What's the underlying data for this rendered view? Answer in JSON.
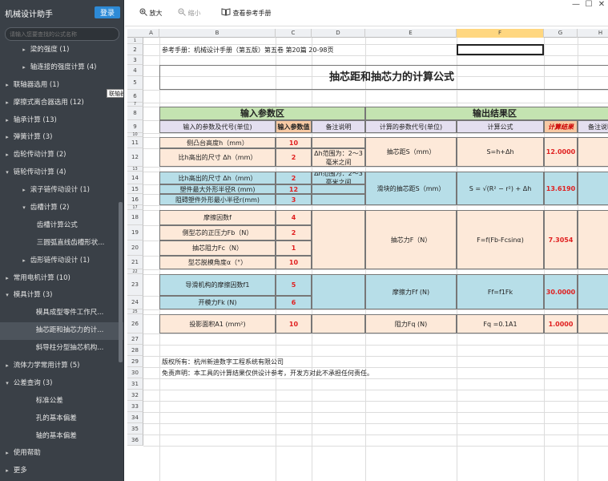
{
  "app": {
    "title": "机械设计助手",
    "login_label": "登录",
    "search_placeholder": "请输入您要查找的公式名称"
  },
  "sidebar": {
    "items": [
      {
        "label": "梁的强度 (1)",
        "level": 1,
        "toggle": "▸"
      },
      {
        "label": "轴连接的强度计算 (4)",
        "level": 1,
        "toggle": "▸"
      },
      {
        "label": "联轴器选用 (1)",
        "level": 0,
        "toggle": "▸",
        "hover": true
      },
      {
        "label": "摩擦式离合器选用 (12)",
        "level": 0,
        "toggle": "▸"
      },
      {
        "label": "轴承计算 (13)",
        "level": 0,
        "toggle": "▸"
      },
      {
        "label": "弹簧计算 (3)",
        "level": 0,
        "toggle": "▸"
      },
      {
        "label": "齿轮传动计算 (2)",
        "level": 0,
        "toggle": "▸"
      },
      {
        "label": "链轮传动计算 (4)",
        "level": 0,
        "toggle": "▾"
      },
      {
        "label": "滚子链传动设计 (1)",
        "level": 1,
        "toggle": "▸"
      },
      {
        "label": "齿槽计算 (2)",
        "level": 1,
        "toggle": "▾"
      },
      {
        "label": "齿槽计算公式",
        "level": 3,
        "toggle": ""
      },
      {
        "label": "三圆弧直线齿槽形状...",
        "level": 3,
        "toggle": ""
      },
      {
        "label": "齿形链传动设计 (1)",
        "level": 1,
        "toggle": "▸"
      },
      {
        "label": "常用电机计算 (10)",
        "level": 0,
        "toggle": "▸"
      },
      {
        "label": "模具计算 (3)",
        "level": 0,
        "toggle": "▾"
      },
      {
        "label": "模具成型零件工作尺...",
        "level": 2,
        "toggle": ""
      },
      {
        "label": "抽芯距和抽芯力的计...",
        "level": 2,
        "toggle": "",
        "selected": true
      },
      {
        "label": "斜导柱分型抽芯机构...",
        "level": 2,
        "toggle": ""
      },
      {
        "label": "流体力学常用计算 (5)",
        "level": 0,
        "toggle": "▸"
      },
      {
        "label": "公差查询 (3)",
        "level": 0,
        "toggle": "▾"
      },
      {
        "label": "标准公差",
        "level": 2,
        "toggle": ""
      },
      {
        "label": "孔的基本偏差",
        "level": 2,
        "toggle": ""
      },
      {
        "label": "轴的基本偏差",
        "level": 2,
        "toggle": ""
      },
      {
        "label": "使用帮助",
        "level": 0,
        "toggle": "▸"
      },
      {
        "label": "更多",
        "level": 0,
        "toggle": "▸"
      }
    ],
    "tooltip": "联轴器选用 (1)"
  },
  "toolbar": {
    "zoom_in": "放大",
    "zoom_out": "缩小",
    "manual": "查看参考手册"
  },
  "window": {
    "min": "—",
    "max": "☐",
    "close": "✕"
  },
  "sheet": {
    "columns": [
      "A",
      "B",
      "C",
      "D",
      "E",
      "F",
      "G",
      "H"
    ],
    "active_column": "F",
    "rows": [
      "1",
      "2",
      "3",
      "4",
      "5",
      "6",
      "7",
      "8",
      "9",
      "10",
      "11",
      "12",
      "13",
      "14",
      "15",
      "16",
      "17",
      "18",
      "19",
      "20",
      "21",
      "22",
      "23",
      "24",
      "25",
      "26",
      "27",
      "28",
      "29",
      "30",
      "31",
      "32",
      "33",
      "34",
      "35",
      "36"
    ],
    "reference": "参考手册：机械设计手册（第五版）第五卷 第20篇 20-98页",
    "title": "抽芯距和抽芯力的计算公式",
    "input_section": "输入参数区",
    "output_section": "输出结果区",
    "headers": {
      "param": "输入的参数及代号(单位)",
      "value": "输入参数值",
      "note": "备注说明",
      "out_param": "计算的参数代号(单位)",
      "formula": "计算公式",
      "result": "计算结果",
      "out_note": "备注说明"
    },
    "inputs": [
      {
        "label": "侧凸台高度h（mm）",
        "value": "10",
        "note": ""
      },
      {
        "label": "比h高出的尺寸 Δh（mm）",
        "value": "2",
        "note": "Δh范围为：2～3毫米之间"
      },
      {
        "label": "比h高出的尺寸 Δh（mm）",
        "value": "2",
        "note": "Δh范围为：2～3毫米之间"
      },
      {
        "label": "塑件最大外形半径R (mm)",
        "value": "12",
        "note": ""
      },
      {
        "label": "阻碍塑件外形最小半径r(mm)",
        "value": "3",
        "note": ""
      },
      {
        "label": "摩擦因数f",
        "value": "4",
        "note": ""
      },
      {
        "label": "侧型芯的正压力Fb（N）",
        "value": "2",
        "note": ""
      },
      {
        "label": "抽芯阻力Fc（N）",
        "value": "1",
        "note": ""
      },
      {
        "label": "型芯脱模角度α（°）",
        "value": "10",
        "note": ""
      },
      {
        "label": "导滑机构的摩擦因数f1",
        "value": "5",
        "note": ""
      },
      {
        "label": "开模力Fk (N)",
        "value": "6",
        "note": ""
      },
      {
        "label": "投影面积A1 (mm²)",
        "value": "10",
        "note": ""
      }
    ],
    "outputs": [
      {
        "label": "抽芯距S（mm）",
        "formula": "S=h+Δh",
        "result": "12.0000"
      },
      {
        "label": "滑块的抽芯距S（mm）",
        "formula": "S = √(R² − r²) + Δh",
        "result": "13.6190"
      },
      {
        "label": "抽芯力F（N）",
        "formula": "F=f(Fb-Fcsinα)",
        "result": "7.3054"
      },
      {
        "label": "摩擦力Ff (N)",
        "formula": "Ff=f1Fk",
        "result": "30.0000"
      },
      {
        "label": "阻力Fq (N)",
        "formula": "Fq =0.1A1",
        "result": "1.0000"
      }
    ],
    "copyright": "版权所有：杭州新迪数字工程系统有限公司",
    "disclaimer": "免责声明：本工具的计算结果仅供设计参考，开发方对此不承担任何责任。"
  },
  "colors": {
    "sidebar_bg": "#3a4047",
    "accent": "#2d8ad6",
    "input_header": "#c4e3b1",
    "pink": "#fde9d9",
    "blue": "#b7dee8",
    "result_red": "#e02020"
  }
}
